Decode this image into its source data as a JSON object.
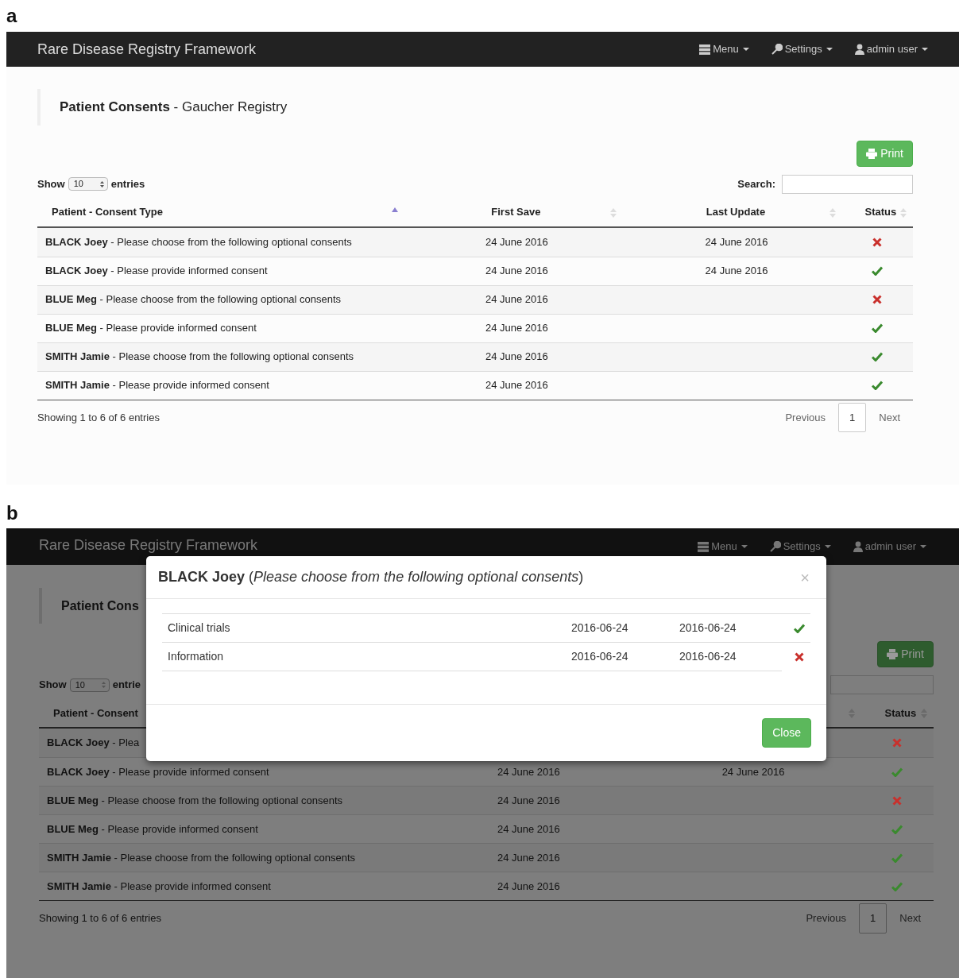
{
  "panels": [
    {
      "label": "a",
      "dimmed": false,
      "navbar": {
        "brand": "Rare Disease Registry Framework",
        "items": [
          {
            "label": "Menu"
          },
          {
            "label": "Settings"
          },
          {
            "label": "admin user"
          }
        ]
      },
      "page_title": "**Patient Consents** - Gaucher Registry",
      "print_button": "Print",
      "show": {
        "before": "Show",
        "value": "10",
        "after": "entries"
      },
      "search_label": "Search:",
      "columns": [
        {
          "label": "Patient - Consent Type",
          "sorted": true
        },
        {
          "label": "First Save",
          "sorted": false
        },
        {
          "label": "Last Update",
          "sorted": false
        },
        {
          "label": "Status",
          "sorted": false
        }
      ],
      "rows": [
        {
          "consent": "**BLACK Joey** - Please choose from the following optional consents",
          "first_save": "24 June 2016",
          "last_update": "24 June 2016",
          "consented": false
        },
        {
          "consent": "**BLACK Joey** - Please provide informed consent",
          "first_save": "24 June 2016",
          "last_update": "24 June 2016",
          "consented": true
        },
        {
          "consent": "**BLUE Meg** - Please choose from the following optional consents",
          "first_save": "24 June 2016",
          "consented": false
        },
        {
          "consent": "**BLUE Meg** - Please provide informed consent",
          "first_save": "24 June 2016",
          "consented": true
        },
        {
          "consent": "**SMITH Jamie** - Please choose from the following optional consents",
          "first_save": "24 June 2016",
          "consented": true
        },
        {
          "consent": "**SMITH Jamie** - Please provide informed consent",
          "first_save": "24 June 2016",
          "consented": true
        }
      ],
      "info": "Showing 1 to 6 of 6 entries",
      "pagination": {
        "previous": "Previous",
        "pages": [
          {
            "label": "1",
            "selected": true
          }
        ],
        "next": "Next"
      }
    },
    {
      "label": "b",
      "dimmed": true,
      "navbar": {
        "brand": "Rare Disease Registry Framework",
        "items": [
          {
            "label": "Menu"
          },
          {
            "label": "Settings"
          },
          {
            "label": "admin user"
          }
        ]
      },
      "page_title": "**Patient Cons**",
      "print_button": "Print",
      "show": {
        "before": "Show",
        "value": "10",
        "after": "entrie"
      },
      "columns": [
        {
          "label": "Patient - Consent"
        },
        {},
        {
          "sorted": false
        },
        {
          "label": "Status",
          "sorted": false
        }
      ],
      "rows": [
        {
          "consent": "**BLACK Joey** - Plea",
          "consented": false
        },
        {
          "consent": "**BLACK Joey** - Please provide informed consent",
          "first_save": "24 June 2016",
          "last_update": "24 June 2016",
          "consented": true
        },
        {
          "consent": "**BLUE Meg** - Please choose from the following optional consents",
          "first_save": "24 June 2016",
          "consented": false
        },
        {
          "consent": "**BLUE Meg** - Please provide informed consent",
          "first_save": "24 June 2016",
          "consented": true
        },
        {
          "consent": "**SMITH Jamie** - Please choose from the following optional consents",
          "first_save": "24 June 2016",
          "consented": true
        },
        {
          "consent": "**SMITH Jamie** - Please provide informed consent",
          "first_save": "24 June 2016",
          "consented": true
        }
      ],
      "info": "Showing 1 to 6 of 6 entries",
      "pagination": {
        "previous": "Previous",
        "pages": [
          {
            "label": "1",
            "selected": true
          }
        ],
        "next": "Next"
      },
      "modal": {
        "title": "**BLACK Joey** (*Please choose from the following optional consents*)",
        "close_symbol": "×",
        "rows": [
          {
            "name": "Clinical trials",
            "first_save": "2016-06-24",
            "last_update": "2016-06-24",
            "consented": true
          },
          {
            "name": "Information",
            "first_save": "2016-06-24",
            "last_update": "2016-06-24",
            "consented": false
          }
        ],
        "close_button": "Close"
      }
    }
  ]
}
